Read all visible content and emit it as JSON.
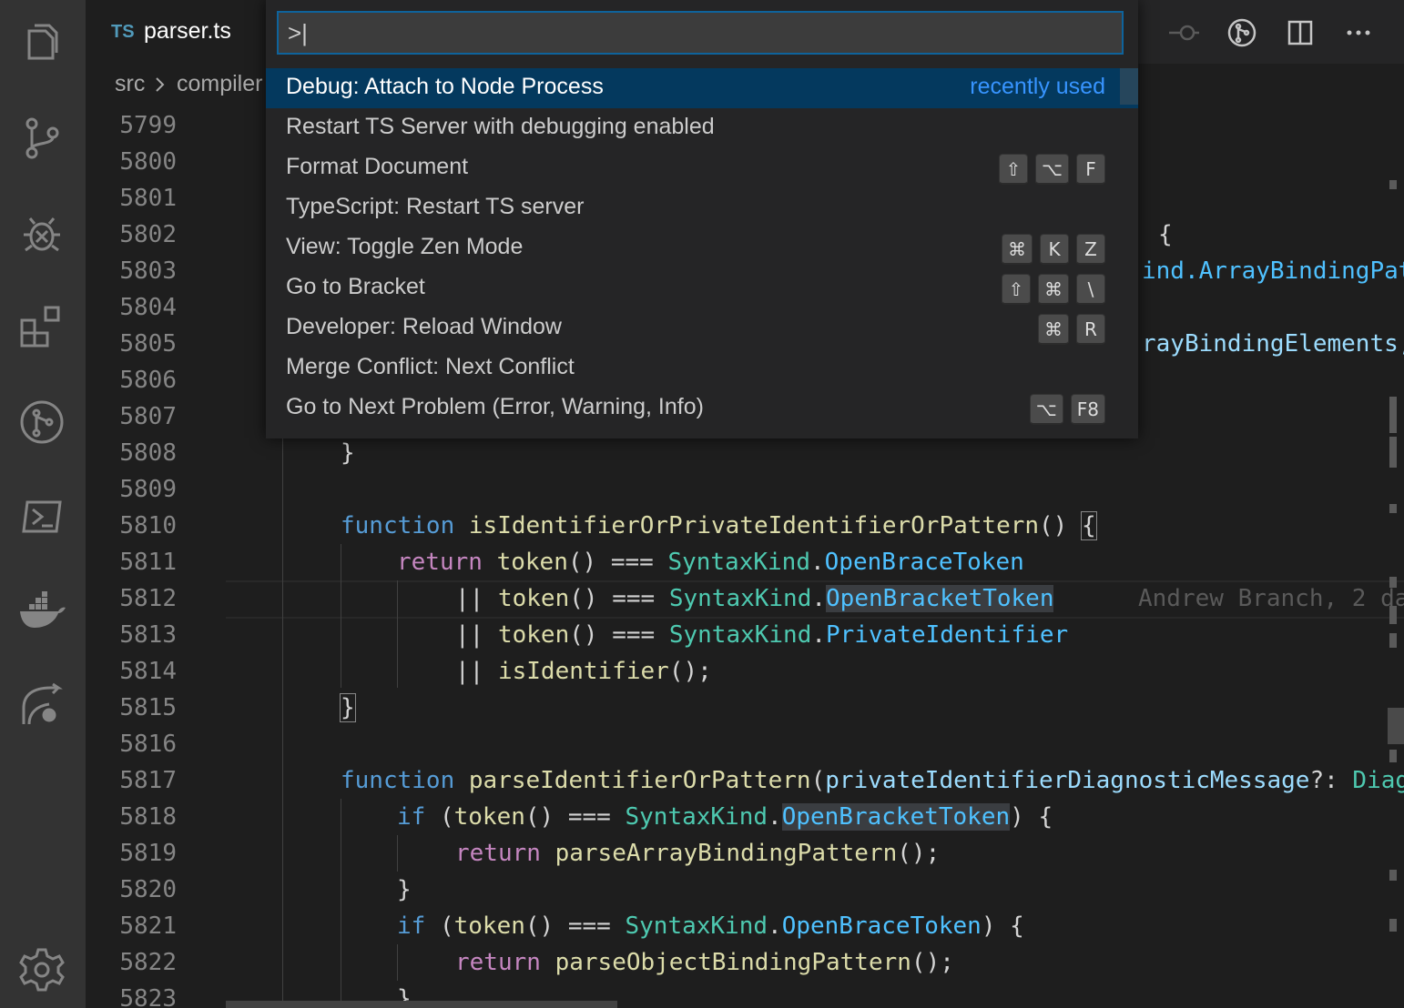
{
  "tab": {
    "lang_badge": "TS",
    "title": "parser.ts"
  },
  "breadcrumb": {
    "part1": "src",
    "part2": "compiler"
  },
  "palette": {
    "input_value": ">|",
    "items": [
      {
        "label": "Debug: Attach to Node Process",
        "badge": "recently used",
        "keys": []
      },
      {
        "label": "Restart TS Server with debugging enabled",
        "keys": []
      },
      {
        "label": "Format Document",
        "keys": [
          "⇧",
          "⌥",
          "F"
        ]
      },
      {
        "label": "TypeScript: Restart TS server",
        "keys": []
      },
      {
        "label": "View: Toggle Zen Mode",
        "keys": [
          "⌘",
          "K",
          "Z"
        ]
      },
      {
        "label": "Go to Bracket",
        "keys": [
          "⇧",
          "⌘",
          "\\"
        ]
      },
      {
        "label": "Developer: Reload Window",
        "keys": [
          "⌘",
          "R"
        ]
      },
      {
        "label": "Merge Conflict: Next Conflict",
        "keys": []
      },
      {
        "label": "Go to Next Problem (Error, Warning, Info)",
        "keys": [
          "⌥",
          "F8"
        ]
      }
    ]
  },
  "line_numbers": [
    "5799",
    "5800",
    "5801",
    "5802",
    "5803",
    "5804",
    "5805",
    "5806",
    "5807",
    "5808",
    "5809",
    "5810",
    "5811",
    "5812",
    "5813",
    "5814",
    "5815",
    "5816",
    "5817",
    "5818",
    "5819",
    "5820",
    "5821",
    "5822",
    "5823"
  ],
  "code": {
    "l5802": "{",
    "l5803": "ind.ArrayBindingPat",
    "l5805": "rayBindingElements,",
    "l5808": "}",
    "l5810_kw": "function",
    "l5810_fn": "isIdentifierOrPrivateIdentifierOrPattern",
    "l5810_rest": "() ",
    "l5810_brace": "{",
    "l5811_kw": "return",
    "l5811_fn": "token",
    "l5811_op": "() === ",
    "l5811_ty": "SyntaxKind",
    "l5811_dot": ".",
    "l5811_pr": "OpenBraceToken",
    "l5812_op": "|| ",
    "l5812_fn": "token",
    "l5812_op2": "() === ",
    "l5812_ty": "SyntaxKind",
    "l5812_dot": ".",
    "l5812_pr": "OpenBracketToken",
    "l5812_blame": "Andrew Branch, 2 da",
    "l5813_op": "|| ",
    "l5813_fn": "token",
    "l5813_op2": "() === ",
    "l5813_ty": "SyntaxKind",
    "l5813_dot": ".",
    "l5813_pr": "PrivateIdentifier",
    "l5814_op": "|| ",
    "l5814_fn": "isIdentifier",
    "l5814_end": "();",
    "l5815": "}",
    "l5817_kw": "function",
    "l5817_fn": "parseIdentifierOrPattern",
    "l5817_p1": "(",
    "l5817_vr": "privateIdentifierDiagnosticMessage",
    "l5817_p2": "?: ",
    "l5817_ty": "Diag",
    "l5818_kw": "if",
    "l5818_p1": " (",
    "l5818_fn": "token",
    "l5818_op": "() === ",
    "l5818_ty": "SyntaxKind",
    "l5818_dot": ".",
    "l5818_pr": "OpenBracketToken",
    "l5818_end": ") {",
    "l5819_kw": "return",
    "l5819_fn": "parseArrayBindingPattern",
    "l5819_end": "();",
    "l5820": "}",
    "l5821_kw": "if",
    "l5821_p1": " (",
    "l5821_fn": "token",
    "l5821_op": "() === ",
    "l5821_ty": "SyntaxKind",
    "l5821_dot": ".",
    "l5821_pr": "OpenBraceToken",
    "l5821_end": ") {",
    "l5822_kw": "return",
    "l5822_fn": "parseObjectBindingPattern",
    "l5822_end": "();",
    "l5823": "}"
  }
}
